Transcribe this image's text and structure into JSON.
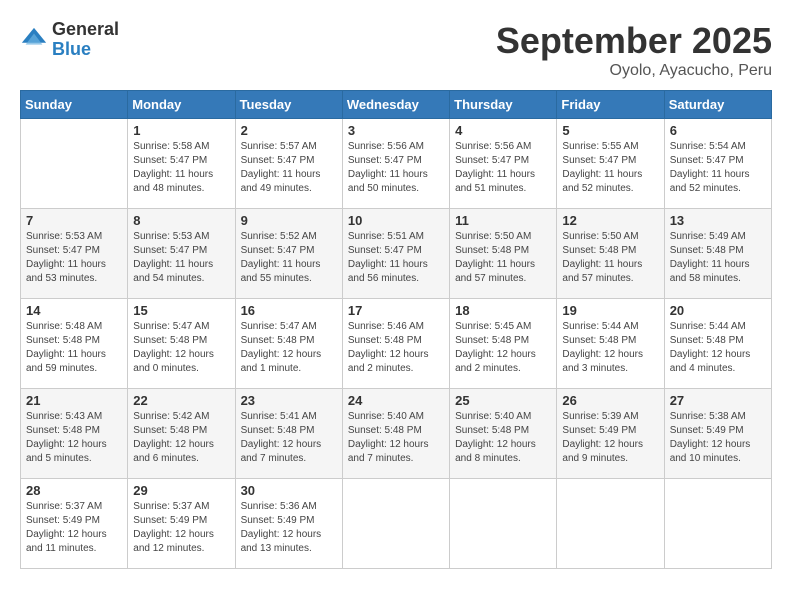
{
  "logo": {
    "general": "General",
    "blue": "Blue"
  },
  "title": "September 2025",
  "subtitle": "Oyolo, Ayacucho, Peru",
  "days_header": [
    "Sunday",
    "Monday",
    "Tuesday",
    "Wednesday",
    "Thursday",
    "Friday",
    "Saturday"
  ],
  "weeks": [
    [
      {
        "day": "",
        "sunrise": "",
        "sunset": "",
        "daylight": ""
      },
      {
        "day": "1",
        "sunrise": "Sunrise: 5:58 AM",
        "sunset": "Sunset: 5:47 PM",
        "daylight": "Daylight: 11 hours and 48 minutes."
      },
      {
        "day": "2",
        "sunrise": "Sunrise: 5:57 AM",
        "sunset": "Sunset: 5:47 PM",
        "daylight": "Daylight: 11 hours and 49 minutes."
      },
      {
        "day": "3",
        "sunrise": "Sunrise: 5:56 AM",
        "sunset": "Sunset: 5:47 PM",
        "daylight": "Daylight: 11 hours and 50 minutes."
      },
      {
        "day": "4",
        "sunrise": "Sunrise: 5:56 AM",
        "sunset": "Sunset: 5:47 PM",
        "daylight": "Daylight: 11 hours and 51 minutes."
      },
      {
        "day": "5",
        "sunrise": "Sunrise: 5:55 AM",
        "sunset": "Sunset: 5:47 PM",
        "daylight": "Daylight: 11 hours and 52 minutes."
      },
      {
        "day": "6",
        "sunrise": "Sunrise: 5:54 AM",
        "sunset": "Sunset: 5:47 PM",
        "daylight": "Daylight: 11 hours and 52 minutes."
      }
    ],
    [
      {
        "day": "7",
        "sunrise": "Sunrise: 5:53 AM",
        "sunset": "Sunset: 5:47 PM",
        "daylight": "Daylight: 11 hours and 53 minutes."
      },
      {
        "day": "8",
        "sunrise": "Sunrise: 5:53 AM",
        "sunset": "Sunset: 5:47 PM",
        "daylight": "Daylight: 11 hours and 54 minutes."
      },
      {
        "day": "9",
        "sunrise": "Sunrise: 5:52 AM",
        "sunset": "Sunset: 5:47 PM",
        "daylight": "Daylight: 11 hours and 55 minutes."
      },
      {
        "day": "10",
        "sunrise": "Sunrise: 5:51 AM",
        "sunset": "Sunset: 5:47 PM",
        "daylight": "Daylight: 11 hours and 56 minutes."
      },
      {
        "day": "11",
        "sunrise": "Sunrise: 5:50 AM",
        "sunset": "Sunset: 5:48 PM",
        "daylight": "Daylight: 11 hours and 57 minutes."
      },
      {
        "day": "12",
        "sunrise": "Sunrise: 5:50 AM",
        "sunset": "Sunset: 5:48 PM",
        "daylight": "Daylight: 11 hours and 57 minutes."
      },
      {
        "day": "13",
        "sunrise": "Sunrise: 5:49 AM",
        "sunset": "Sunset: 5:48 PM",
        "daylight": "Daylight: 11 hours and 58 minutes."
      }
    ],
    [
      {
        "day": "14",
        "sunrise": "Sunrise: 5:48 AM",
        "sunset": "Sunset: 5:48 PM",
        "daylight": "Daylight: 11 hours and 59 minutes."
      },
      {
        "day": "15",
        "sunrise": "Sunrise: 5:47 AM",
        "sunset": "Sunset: 5:48 PM",
        "daylight": "Daylight: 12 hours and 0 minutes."
      },
      {
        "day": "16",
        "sunrise": "Sunrise: 5:47 AM",
        "sunset": "Sunset: 5:48 PM",
        "daylight": "Daylight: 12 hours and 1 minute."
      },
      {
        "day": "17",
        "sunrise": "Sunrise: 5:46 AM",
        "sunset": "Sunset: 5:48 PM",
        "daylight": "Daylight: 12 hours and 2 minutes."
      },
      {
        "day": "18",
        "sunrise": "Sunrise: 5:45 AM",
        "sunset": "Sunset: 5:48 PM",
        "daylight": "Daylight: 12 hours and 2 minutes."
      },
      {
        "day": "19",
        "sunrise": "Sunrise: 5:44 AM",
        "sunset": "Sunset: 5:48 PM",
        "daylight": "Daylight: 12 hours and 3 minutes."
      },
      {
        "day": "20",
        "sunrise": "Sunrise: 5:44 AM",
        "sunset": "Sunset: 5:48 PM",
        "daylight": "Daylight: 12 hours and 4 minutes."
      }
    ],
    [
      {
        "day": "21",
        "sunrise": "Sunrise: 5:43 AM",
        "sunset": "Sunset: 5:48 PM",
        "daylight": "Daylight: 12 hours and 5 minutes."
      },
      {
        "day": "22",
        "sunrise": "Sunrise: 5:42 AM",
        "sunset": "Sunset: 5:48 PM",
        "daylight": "Daylight: 12 hours and 6 minutes."
      },
      {
        "day": "23",
        "sunrise": "Sunrise: 5:41 AM",
        "sunset": "Sunset: 5:48 PM",
        "daylight": "Daylight: 12 hours and 7 minutes."
      },
      {
        "day": "24",
        "sunrise": "Sunrise: 5:40 AM",
        "sunset": "Sunset: 5:48 PM",
        "daylight": "Daylight: 12 hours and 7 minutes."
      },
      {
        "day": "25",
        "sunrise": "Sunrise: 5:40 AM",
        "sunset": "Sunset: 5:48 PM",
        "daylight": "Daylight: 12 hours and 8 minutes."
      },
      {
        "day": "26",
        "sunrise": "Sunrise: 5:39 AM",
        "sunset": "Sunset: 5:49 PM",
        "daylight": "Daylight: 12 hours and 9 minutes."
      },
      {
        "day": "27",
        "sunrise": "Sunrise: 5:38 AM",
        "sunset": "Sunset: 5:49 PM",
        "daylight": "Daylight: 12 hours and 10 minutes."
      }
    ],
    [
      {
        "day": "28",
        "sunrise": "Sunrise: 5:37 AM",
        "sunset": "Sunset: 5:49 PM",
        "daylight": "Daylight: 12 hours and 11 minutes."
      },
      {
        "day": "29",
        "sunrise": "Sunrise: 5:37 AM",
        "sunset": "Sunset: 5:49 PM",
        "daylight": "Daylight: 12 hours and 12 minutes."
      },
      {
        "day": "30",
        "sunrise": "Sunrise: 5:36 AM",
        "sunset": "Sunset: 5:49 PM",
        "daylight": "Daylight: 12 hours and 13 minutes."
      },
      {
        "day": "",
        "sunrise": "",
        "sunset": "",
        "daylight": ""
      },
      {
        "day": "",
        "sunrise": "",
        "sunset": "",
        "daylight": ""
      },
      {
        "day": "",
        "sunrise": "",
        "sunset": "",
        "daylight": ""
      },
      {
        "day": "",
        "sunrise": "",
        "sunset": "",
        "daylight": ""
      }
    ]
  ]
}
